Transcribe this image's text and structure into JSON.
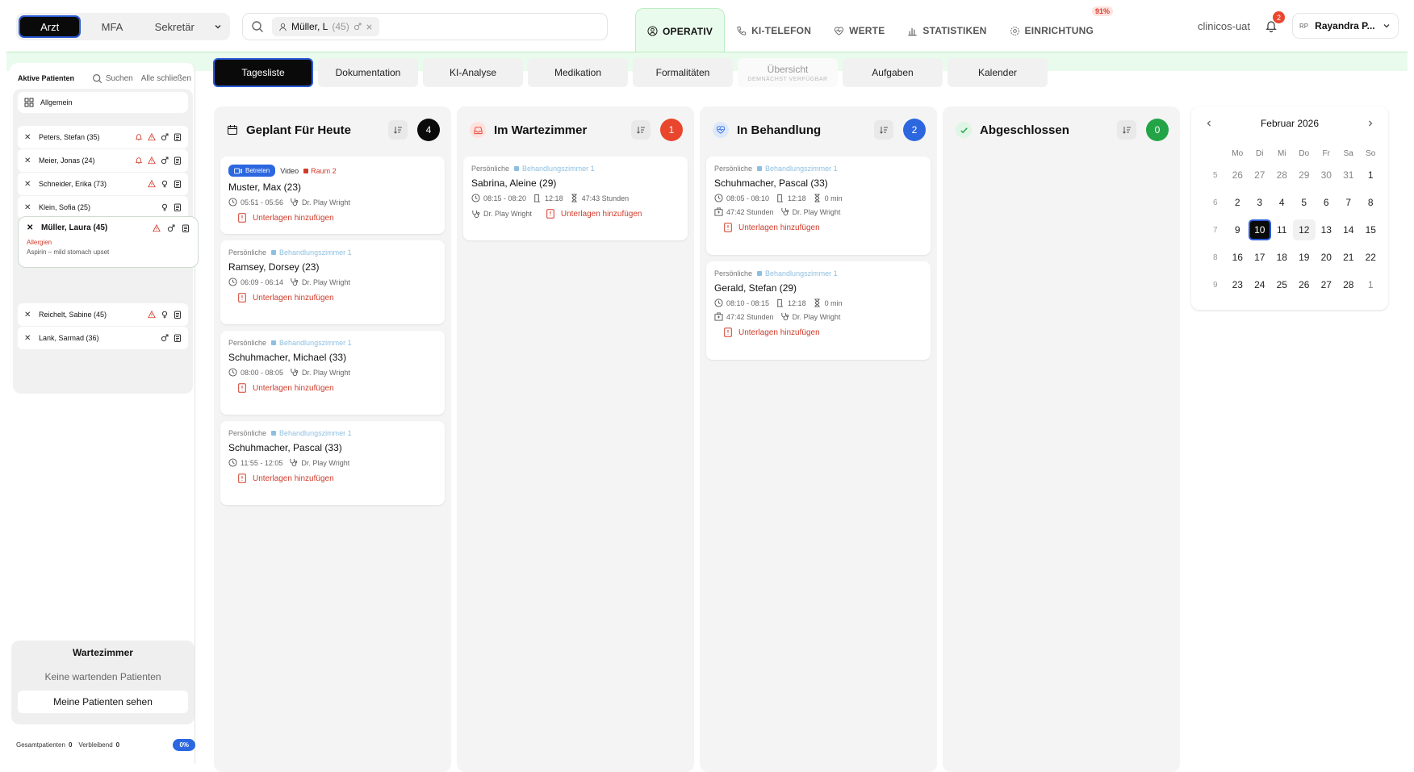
{
  "roles": {
    "items": [
      "Arzt",
      "MFA",
      "Sekretär"
    ],
    "active": "Arzt"
  },
  "search": {
    "chip_name": "Müller, L",
    "chip_age": "(45)"
  },
  "nav": {
    "items": [
      "OPERATIV",
      "KI-TELEFON",
      "WERTE",
      "STATISTIKEN",
      "EINRICHTUNG"
    ],
    "active": "OPERATIV",
    "einrichtung_badge": "91%"
  },
  "user": {
    "org": "clinicos-uat",
    "notifications": "2",
    "initials": "RP",
    "name": "Rayandra P..."
  },
  "sidebar": {
    "title": "Aktive Patienten",
    "search_label": "Suchen",
    "close_all": "Alle schließen",
    "general": "Allgemein",
    "patients": [
      {
        "name": "Peters, Stefan (35)"
      },
      {
        "name": "Meier, Jonas (24)"
      },
      {
        "name": "Schneider, Erika (73)"
      },
      {
        "name": "Klein, Sofia (25)"
      },
      {
        "name": "Reichelt, Sabine (45)"
      },
      {
        "name": "Lank, Sarmad (36)"
      }
    ],
    "active_patient": {
      "name": "Müller, Laura (45)",
      "allergy_label": "Allergien",
      "allergy_note": "Aspirin – mild stomach upset"
    },
    "waiting": {
      "title": "Wartezimmer",
      "empty": "Keine wartenden Patienten",
      "button": "Meine Patienten sehen"
    },
    "stats": {
      "total_label": "Gesamtpatienten",
      "total": "0",
      "remaining_label": "Verbleibend",
      "remaining": "0",
      "pct": "0%"
    }
  },
  "tabs": [
    {
      "label": "Tagesliste",
      "sub": ""
    },
    {
      "label": "Dokumentation",
      "sub": ""
    },
    {
      "label": "KI-Analyse",
      "sub": ""
    },
    {
      "label": "Medikation",
      "sub": ""
    },
    {
      "label": "Formalitäten",
      "sub": ""
    },
    {
      "label": "Übersicht",
      "sub": "DEMNÄCHST VERFÜGBAR"
    },
    {
      "label": "Aufgaben",
      "sub": ""
    },
    {
      "label": "Kalender",
      "sub": ""
    }
  ],
  "columns": [
    {
      "title": "Geplant Für Heute",
      "count": "4",
      "color": "#0a0a0a"
    },
    {
      "title": "Im Wartezimmer",
      "count": "1",
      "color": "#e9462d"
    },
    {
      "title": "In Behandlung",
      "count": "2",
      "color": "#2c67e0"
    },
    {
      "title": "Abgeschlossen",
      "count": "0",
      "color": "#22a447"
    }
  ],
  "cards": {
    "add_label": "Unterlagen hinzufügen",
    "type_personal": "Persönliche",
    "room": "Behandlungszimmer 1",
    "doctor": "Dr. Play Wright",
    "planned": [
      {
        "name": "Muster, Max (23)",
        "time": "05:51 - 05:56",
        "join": "Betreten",
        "mode": "Video",
        "room": "Raum 2"
      },
      {
        "name": "Ramsey, Dorsey (23)",
        "time": "06:09 - 06:14"
      },
      {
        "name": "Schuhmacher, Michael (33)",
        "time": "08:00 - 08:05"
      },
      {
        "name": "Schuhmacher, Pascal (33)",
        "time": "11:55 - 12:05"
      }
    ],
    "waiting": [
      {
        "name": "Sabrina, Aleine (29)",
        "time": "08:15 - 08:20",
        "arrived": "12:18",
        "wait": "47:43 Stunden"
      }
    ],
    "treatment": [
      {
        "name": "Schuhmacher, Pascal (33)",
        "time": "08:05 - 08:10",
        "arrived": "12:18",
        "wait": "0 min",
        "total": "47:42 Stunden"
      },
      {
        "name": "Gerald, Stefan (29)",
        "time": "08:10 - 08:15",
        "arrived": "12:18",
        "wait": "0 min",
        "total": "47:42 Stunden"
      }
    ]
  },
  "calendar": {
    "month": "Februar 2026",
    "dow": [
      "Mo",
      "Di",
      "Mi",
      "Do",
      "Fr",
      "Sa",
      "So"
    ],
    "weeks": [
      {
        "wk": "5",
        "days": [
          "26",
          "27",
          "28",
          "29",
          "30",
          "31",
          "1"
        ]
      },
      {
        "wk": "6",
        "days": [
          "2",
          "3",
          "4",
          "5",
          "6",
          "7",
          "8"
        ]
      },
      {
        "wk": "7",
        "days": [
          "9",
          "10",
          "11",
          "12",
          "13",
          "14",
          "15"
        ]
      },
      {
        "wk": "8",
        "days": [
          "16",
          "17",
          "18",
          "19",
          "20",
          "21",
          "22"
        ]
      },
      {
        "wk": "9",
        "days": [
          "23",
          "24",
          "25",
          "26",
          "27",
          "28",
          "1"
        ]
      }
    ]
  }
}
